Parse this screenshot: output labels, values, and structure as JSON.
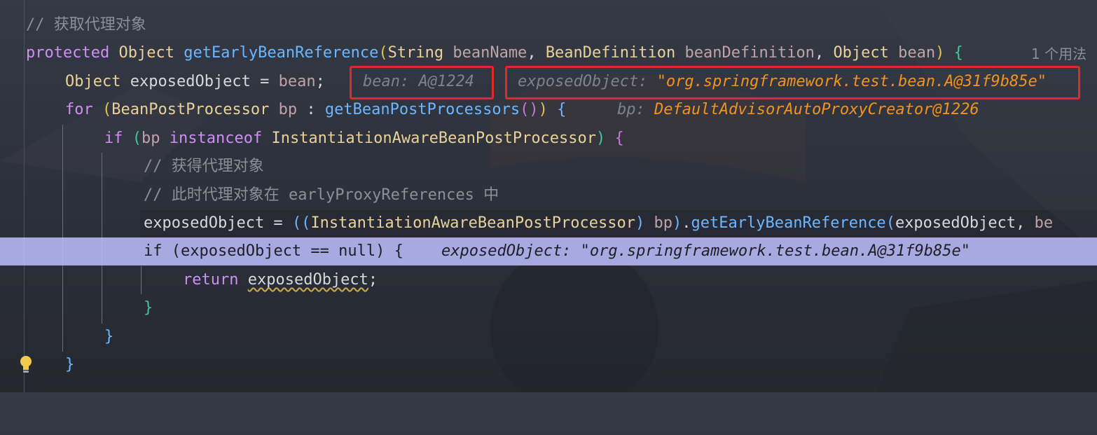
{
  "colors": {
    "keyword": "#cf8ef5",
    "type": "#e8d29a",
    "function": "#6cb6ff",
    "comment": "#8b8f98",
    "hint_orange": "#f0931f",
    "highlight_line": "#bebeff",
    "red_box": "#e02a2a"
  },
  "lines": {
    "l1": {
      "comment": "// 获取代理对象"
    },
    "l2": {
      "kw": "protected",
      "ret_type": "Object",
      "method": "getEarlyBeanReference",
      "p1_type": "String",
      "p1_name": "beanName",
      "p2_type": "BeanDefinition",
      "p2_name": "beanDefinition",
      "p3_type": "Object",
      "p3_name": "bean",
      "usages": "1 个用法"
    },
    "l3": {
      "type": "Object",
      "var": "exposedObject",
      "op": "=",
      "value": "bean",
      "hint1_label": "bean:",
      "hint1_value": "A@1224",
      "hint2_label": "exposedObject:",
      "hint2_value": "\"org.springframework.test.bean.A@31f9b85e\""
    },
    "l4": {
      "kw": "for",
      "type": "BeanPostProcessor",
      "var": "bp",
      "method": "getBeanPostProcessors",
      "hint_label": "bp:",
      "hint_value": "DefaultAdvisorAutoProxyCreator@1226"
    },
    "l5": {
      "kw": "if",
      "var": "bp",
      "kw2": "instanceof",
      "type": "InstantiationAwareBeanPostProcessor"
    },
    "l6": {
      "comment": "// 获得代理对象"
    },
    "l7": {
      "comment": "// 此时代理对象在 earlyProxyReferences 中"
    },
    "l8": {
      "var": "exposedObject",
      "type": "InstantiationAwareBeanPostProcessor",
      "cast_var": "bp",
      "method": "getEarlyBeanReference",
      "arg": "exposedObject",
      "trail": "be"
    },
    "l9": {
      "kw": "if",
      "expr": "(exposedObject == null) {",
      "hint": "exposedObject: \"org.springframework.test.bean.A@31f9b85e\""
    },
    "l10": {
      "kw": "return",
      "var": "exposedObject"
    },
    "l11": {
      "brace": "}"
    },
    "l12": {
      "brace": "}"
    },
    "l13": {
      "brace": "}"
    }
  }
}
